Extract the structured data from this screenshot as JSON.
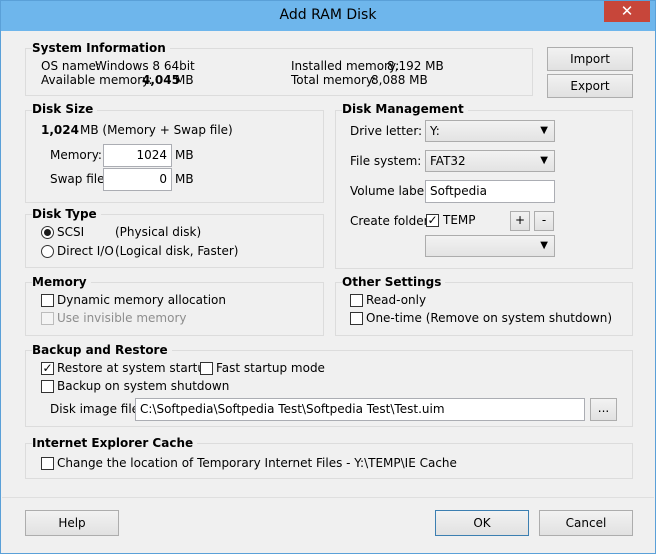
{
  "window": {
    "title": "Add RAM Disk",
    "close_glyph": "✕"
  },
  "system_info": {
    "title": "System Information",
    "os_label": "OS name:",
    "os_value": "Windows 8 64bit",
    "avail_label": "Available memory:",
    "avail_value": "4,045",
    "avail_unit": "MB",
    "installed_label": "Installed memory:",
    "installed_value": "8,192 MB",
    "total_label": "Total memory:",
    "total_value": "8,088 MB",
    "import_label": "Import",
    "export_label": "Export"
  },
  "disk_size": {
    "title": "Disk Size",
    "total_value": "1,024",
    "total_suffix": "MB (Memory + Swap file)",
    "memory_label": "Memory:",
    "memory_value": "1024",
    "swap_label": "Swap file:",
    "swap_value": "0",
    "unit": "MB"
  },
  "disk_management": {
    "title": "Disk Management",
    "drive_letter_label": "Drive letter:",
    "drive_letter_value": "Y:",
    "file_system_label": "File system:",
    "file_system_value": "FAT32",
    "volume_label_label": "Volume label:",
    "volume_label_value": "Softpedia",
    "create_folder_label": "Create folder:",
    "create_folder_value": "TEMP",
    "plus_label": "+",
    "minus_label": "-",
    "folder_combo_value": ""
  },
  "disk_type": {
    "title": "Disk Type",
    "scsi_label": "SCSI",
    "scsi_desc": "(Physical disk)",
    "directio_label": "Direct I/O",
    "directio_desc": "(Logical disk, Faster)"
  },
  "memory": {
    "title": "Memory",
    "dynamic_label": "Dynamic memory allocation",
    "invisible_label": "Use invisible memory"
  },
  "other_settings": {
    "title": "Other Settings",
    "readonly_label": "Read-only",
    "onetime_label": "One-time (Remove on system shutdown)"
  },
  "backup": {
    "title": "Backup and Restore",
    "restore_label": "Restore at system startup",
    "fast_label": "Fast startup mode",
    "backup_label": "Backup on system shutdown",
    "image_label": "Disk image file:",
    "image_value": "C:\\Softpedia\\Softpedia Test\\Softpedia Test\\Test.uim",
    "browse_label": "..."
  },
  "ie_cache": {
    "title": "Internet Explorer Cache",
    "change_label": "Change the location of Temporary Internet Files - Y:\\TEMP\\IE Cache"
  },
  "footer": {
    "help_label": "Help",
    "ok_label": "OK",
    "cancel_label": "Cancel"
  },
  "glyphs": {
    "check": "✓",
    "arrow": "▼"
  }
}
